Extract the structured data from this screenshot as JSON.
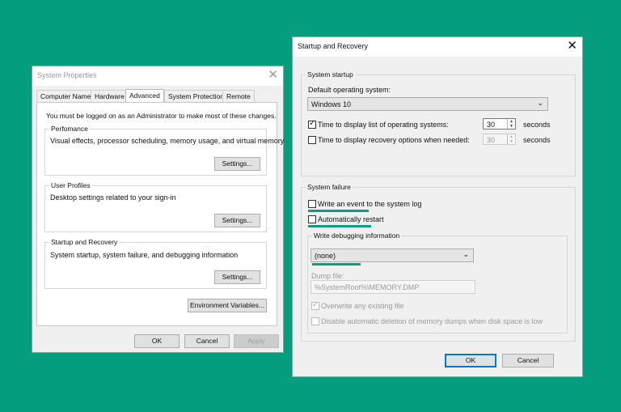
{
  "sysprops": {
    "title": "System Properties",
    "tabs": [
      "Computer Name",
      "Hardware",
      "Advanced",
      "System Protection",
      "Remote"
    ],
    "admin_notice": "You must be logged on as an Administrator to make most of these changes.",
    "performance": {
      "legend": "Perfomance",
      "desc": "Visual effects, processor scheduling, memory usage, and virtual memory",
      "button": "Settings..."
    },
    "user_profiles": {
      "legend": "User Profiles",
      "desc": "Desktop settings related to your sign-in",
      "button": "Settings..."
    },
    "startup_recovery": {
      "legend": "Startup and Recovery",
      "desc": "System startup, system failure, and debugging information",
      "button": "Settings..."
    },
    "env_button": "Environment Variables...",
    "ok": "OK",
    "cancel": "Cancel",
    "apply": "Apply"
  },
  "sr": {
    "title": "Startup and Recovery",
    "system_startup": {
      "legend": "System startup",
      "default_os_label": "Default operating system:",
      "default_os_value": "Windows 10",
      "time_list": {
        "label": "Time to display list of operating systems:",
        "checked": true,
        "value": "30",
        "unit": "seconds"
      },
      "time_recovery": {
        "label": "Time to display recovery options when needed:",
        "checked": false,
        "value": "30",
        "unit": "seconds"
      }
    },
    "system_failure": {
      "legend": "System failure",
      "write_event": {
        "label": "Write an event to the system log",
        "checked": false
      },
      "auto_restart": {
        "label": "Automatically restart",
        "checked": false
      },
      "debug_group": {
        "legend": "Write debugging information",
        "selected": "(none)",
        "dump_file_label": "Dump file:",
        "dump_file_value": "%SystemRoot%\\MEMORY.DMP",
        "overwrite": {
          "label": "Overwrite any existing file",
          "checked": true
        },
        "disable_auto_delete": {
          "label": "Disable automatic deletion of memory dumps when disk space is low",
          "checked": false
        }
      }
    },
    "ok": "OK",
    "cancel": "Cancel"
  },
  "colors": {
    "background": "#049d7d",
    "highlight_underline": "#0f9c7e",
    "accent": "#0078d7"
  },
  "icons": {
    "close": "close-icon",
    "chevron": "chevron-down-icon",
    "spin": "spin-arrows-icon"
  }
}
